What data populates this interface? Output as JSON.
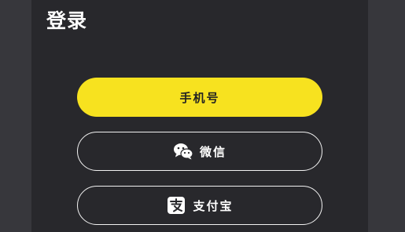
{
  "login": {
    "title": "登录",
    "buttons": {
      "phone_label": "手机号",
      "wechat_label": "微信",
      "alipay_label": "支付宝"
    }
  },
  "icons": {
    "wechat": "wechat-icon",
    "alipay": "alipay-icon"
  },
  "colors": {
    "page_background": "#37373c",
    "panel_background": "#28282c",
    "primary_button": "#f7e21f",
    "outline": "#f2f2f2",
    "text_light": "#ffffff",
    "text_dark": "#222222"
  }
}
